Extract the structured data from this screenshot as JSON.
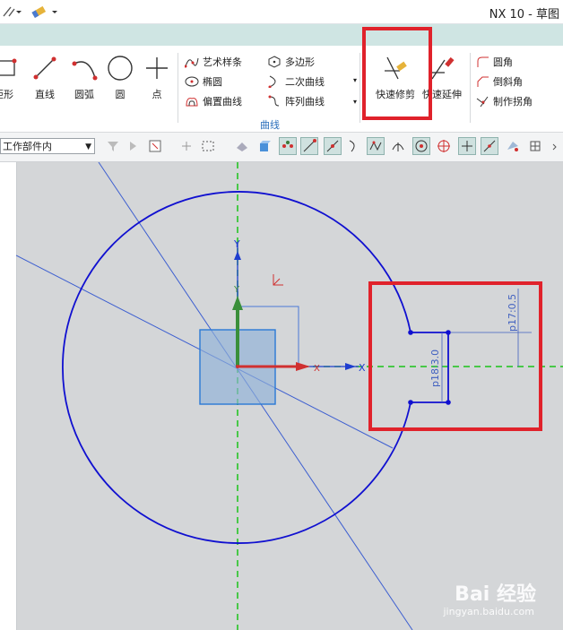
{
  "window": {
    "title": "NX 10 - 草图"
  },
  "ribbon": {
    "buttons": {
      "rectangle": "矩形",
      "line": "直线",
      "arc": "圆弧",
      "circle": "圆",
      "point": "点",
      "quick_trim": "快速修剪",
      "quick_extend": "快速延伸"
    },
    "curve_items": {
      "studio_spline": "艺术样条",
      "ellipse": "椭圆",
      "offset_curve": "偏置曲线",
      "polygon": "多边形",
      "conic": "二次曲线",
      "pattern_curve": "阵列曲线"
    },
    "corner_items": {
      "fillet": "圆角",
      "chamfer": "倒斜角",
      "make_corner": "制作拐角"
    },
    "group_label": "曲线"
  },
  "toolbar": {
    "part_scope": "工作部件内"
  },
  "canvas": {
    "axis_labels": {
      "x_axis": "X",
      "y_axis": "Y",
      "x_csys": "X",
      "y_csys": "Y"
    },
    "dimensions": {
      "d1": "p18:3.0",
      "d2": "p17:0.5"
    },
    "colors": {
      "sketch_curve": "#1010d0",
      "highlight_box": "#e0222b",
      "datum_axis": "#19c419",
      "background": "#d4d6d8"
    }
  },
  "watermark": {
    "brand": "Bai 经验",
    "url": "jingyan.baidu.com"
  }
}
